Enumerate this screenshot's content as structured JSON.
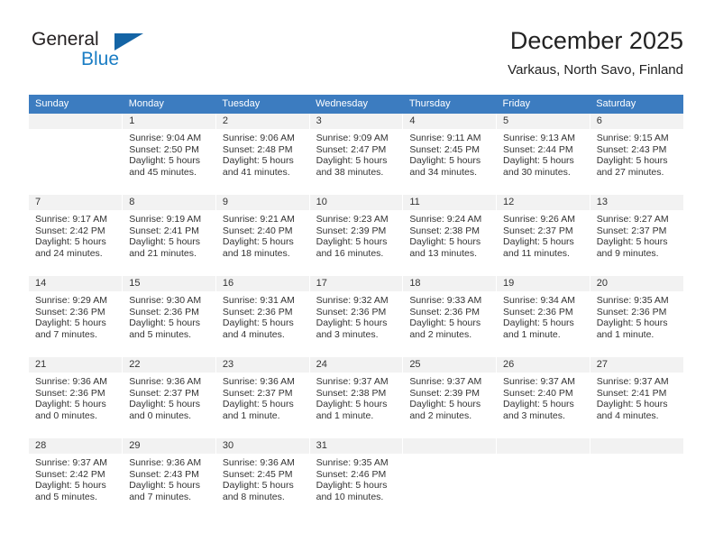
{
  "brand": {
    "name_top": "General",
    "name_bottom": "Blue",
    "triangle_color": "#1464a5",
    "blue_color": "#1a7dc4"
  },
  "header": {
    "title": "December 2025",
    "subtitle": "Varkaus, North Savo, Finland"
  },
  "theme": {
    "header_row_bg": "#3c7cc0",
    "header_row_text": "#ffffff",
    "daynum_bg": "#f2f2f2",
    "cell_bg": "#ffffff",
    "text": "#333333"
  },
  "calendar": {
    "weekday_headers": [
      "Sunday",
      "Monday",
      "Tuesday",
      "Wednesday",
      "Thursday",
      "Friday",
      "Saturday"
    ],
    "weeks": [
      [
        {
          "day": "",
          "lines": []
        },
        {
          "day": "1",
          "lines": [
            "Sunrise: 9:04 AM",
            "Sunset: 2:50 PM",
            "Daylight: 5 hours",
            "and 45 minutes."
          ]
        },
        {
          "day": "2",
          "lines": [
            "Sunrise: 9:06 AM",
            "Sunset: 2:48 PM",
            "Daylight: 5 hours",
            "and 41 minutes."
          ]
        },
        {
          "day": "3",
          "lines": [
            "Sunrise: 9:09 AM",
            "Sunset: 2:47 PM",
            "Daylight: 5 hours",
            "and 38 minutes."
          ]
        },
        {
          "day": "4",
          "lines": [
            "Sunrise: 9:11 AM",
            "Sunset: 2:45 PM",
            "Daylight: 5 hours",
            "and 34 minutes."
          ]
        },
        {
          "day": "5",
          "lines": [
            "Sunrise: 9:13 AM",
            "Sunset: 2:44 PM",
            "Daylight: 5 hours",
            "and 30 minutes."
          ]
        },
        {
          "day": "6",
          "lines": [
            "Sunrise: 9:15 AM",
            "Sunset: 2:43 PM",
            "Daylight: 5 hours",
            "and 27 minutes."
          ]
        }
      ],
      [
        {
          "day": "7",
          "lines": [
            "Sunrise: 9:17 AM",
            "Sunset: 2:42 PM",
            "Daylight: 5 hours",
            "and 24 minutes."
          ]
        },
        {
          "day": "8",
          "lines": [
            "Sunrise: 9:19 AM",
            "Sunset: 2:41 PM",
            "Daylight: 5 hours",
            "and 21 minutes."
          ]
        },
        {
          "day": "9",
          "lines": [
            "Sunrise: 9:21 AM",
            "Sunset: 2:40 PM",
            "Daylight: 5 hours",
            "and 18 minutes."
          ]
        },
        {
          "day": "10",
          "lines": [
            "Sunrise: 9:23 AM",
            "Sunset: 2:39 PM",
            "Daylight: 5 hours",
            "and 16 minutes."
          ]
        },
        {
          "day": "11",
          "lines": [
            "Sunrise: 9:24 AM",
            "Sunset: 2:38 PM",
            "Daylight: 5 hours",
            "and 13 minutes."
          ]
        },
        {
          "day": "12",
          "lines": [
            "Sunrise: 9:26 AM",
            "Sunset: 2:37 PM",
            "Daylight: 5 hours",
            "and 11 minutes."
          ]
        },
        {
          "day": "13",
          "lines": [
            "Sunrise: 9:27 AM",
            "Sunset: 2:37 PM",
            "Daylight: 5 hours",
            "and 9 minutes."
          ]
        }
      ],
      [
        {
          "day": "14",
          "lines": [
            "Sunrise: 9:29 AM",
            "Sunset: 2:36 PM",
            "Daylight: 5 hours",
            "and 7 minutes."
          ]
        },
        {
          "day": "15",
          "lines": [
            "Sunrise: 9:30 AM",
            "Sunset: 2:36 PM",
            "Daylight: 5 hours",
            "and 5 minutes."
          ]
        },
        {
          "day": "16",
          "lines": [
            "Sunrise: 9:31 AM",
            "Sunset: 2:36 PM",
            "Daylight: 5 hours",
            "and 4 minutes."
          ]
        },
        {
          "day": "17",
          "lines": [
            "Sunrise: 9:32 AM",
            "Sunset: 2:36 PM",
            "Daylight: 5 hours",
            "and 3 minutes."
          ]
        },
        {
          "day": "18",
          "lines": [
            "Sunrise: 9:33 AM",
            "Sunset: 2:36 PM",
            "Daylight: 5 hours",
            "and 2 minutes."
          ]
        },
        {
          "day": "19",
          "lines": [
            "Sunrise: 9:34 AM",
            "Sunset: 2:36 PM",
            "Daylight: 5 hours",
            "and 1 minute."
          ]
        },
        {
          "day": "20",
          "lines": [
            "Sunrise: 9:35 AM",
            "Sunset: 2:36 PM",
            "Daylight: 5 hours",
            "and 1 minute."
          ]
        }
      ],
      [
        {
          "day": "21",
          "lines": [
            "Sunrise: 9:36 AM",
            "Sunset: 2:36 PM",
            "Daylight: 5 hours",
            "and 0 minutes."
          ]
        },
        {
          "day": "22",
          "lines": [
            "Sunrise: 9:36 AM",
            "Sunset: 2:37 PM",
            "Daylight: 5 hours",
            "and 0 minutes."
          ]
        },
        {
          "day": "23",
          "lines": [
            "Sunrise: 9:36 AM",
            "Sunset: 2:37 PM",
            "Daylight: 5 hours",
            "and 1 minute."
          ]
        },
        {
          "day": "24",
          "lines": [
            "Sunrise: 9:37 AM",
            "Sunset: 2:38 PM",
            "Daylight: 5 hours",
            "and 1 minute."
          ]
        },
        {
          "day": "25",
          "lines": [
            "Sunrise: 9:37 AM",
            "Sunset: 2:39 PM",
            "Daylight: 5 hours",
            "and 2 minutes."
          ]
        },
        {
          "day": "26",
          "lines": [
            "Sunrise: 9:37 AM",
            "Sunset: 2:40 PM",
            "Daylight: 5 hours",
            "and 3 minutes."
          ]
        },
        {
          "day": "27",
          "lines": [
            "Sunrise: 9:37 AM",
            "Sunset: 2:41 PM",
            "Daylight: 5 hours",
            "and 4 minutes."
          ]
        }
      ],
      [
        {
          "day": "28",
          "lines": [
            "Sunrise: 9:37 AM",
            "Sunset: 2:42 PM",
            "Daylight: 5 hours",
            "and 5 minutes."
          ]
        },
        {
          "day": "29",
          "lines": [
            "Sunrise: 9:36 AM",
            "Sunset: 2:43 PM",
            "Daylight: 5 hours",
            "and 7 minutes."
          ]
        },
        {
          "day": "30",
          "lines": [
            "Sunrise: 9:36 AM",
            "Sunset: 2:45 PM",
            "Daylight: 5 hours",
            "and 8 minutes."
          ]
        },
        {
          "day": "31",
          "lines": [
            "Sunrise: 9:35 AM",
            "Sunset: 2:46 PM",
            "Daylight: 5 hours",
            "and 10 minutes."
          ]
        },
        {
          "day": "",
          "lines": []
        },
        {
          "day": "",
          "lines": []
        },
        {
          "day": "",
          "lines": []
        }
      ]
    ]
  }
}
